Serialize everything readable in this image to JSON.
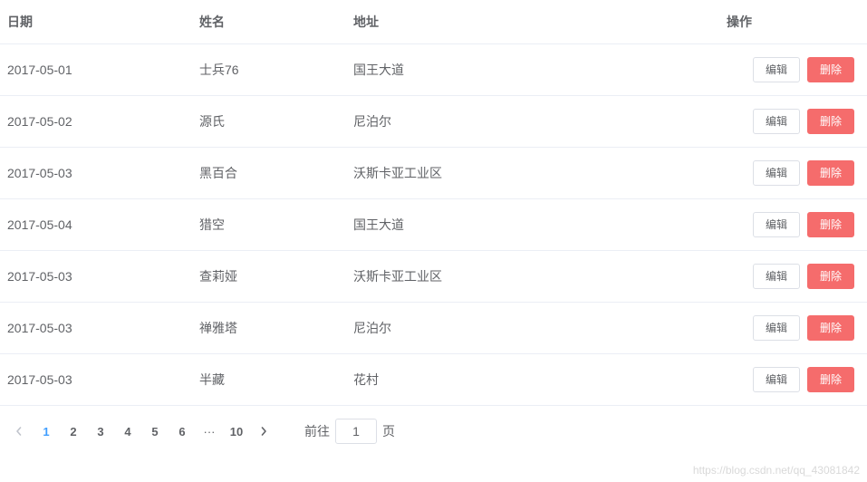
{
  "table": {
    "headers": {
      "date": "日期",
      "name": "姓名",
      "addr": "地址",
      "op": "操作"
    },
    "buttons": {
      "edit": "编辑",
      "delete": "删除"
    },
    "rows": [
      {
        "date": "2017-05-01",
        "name": "士兵76",
        "addr": "国王大道"
      },
      {
        "date": "2017-05-02",
        "name": "源氏",
        "addr": "尼泊尔"
      },
      {
        "date": "2017-05-03",
        "name": "黑百合",
        "addr": "沃斯卡亚工业区"
      },
      {
        "date": "2017-05-04",
        "name": "猎空",
        "addr": "国王大道"
      },
      {
        "date": "2017-05-03",
        "name": "查莉娅",
        "addr": "沃斯卡亚工业区"
      },
      {
        "date": "2017-05-03",
        "name": "禅雅塔",
        "addr": "尼泊尔"
      },
      {
        "date": "2017-05-03",
        "name": "半藏",
        "addr": "花村"
      }
    ]
  },
  "pagination": {
    "pages": [
      "1",
      "2",
      "3",
      "4",
      "5",
      "6",
      "10"
    ],
    "ellipsis": "···",
    "active": "1",
    "jumper": {
      "prefix": "前往",
      "value": "1",
      "suffix": "页"
    }
  },
  "watermark": "https://blog.csdn.net/qq_43081842"
}
